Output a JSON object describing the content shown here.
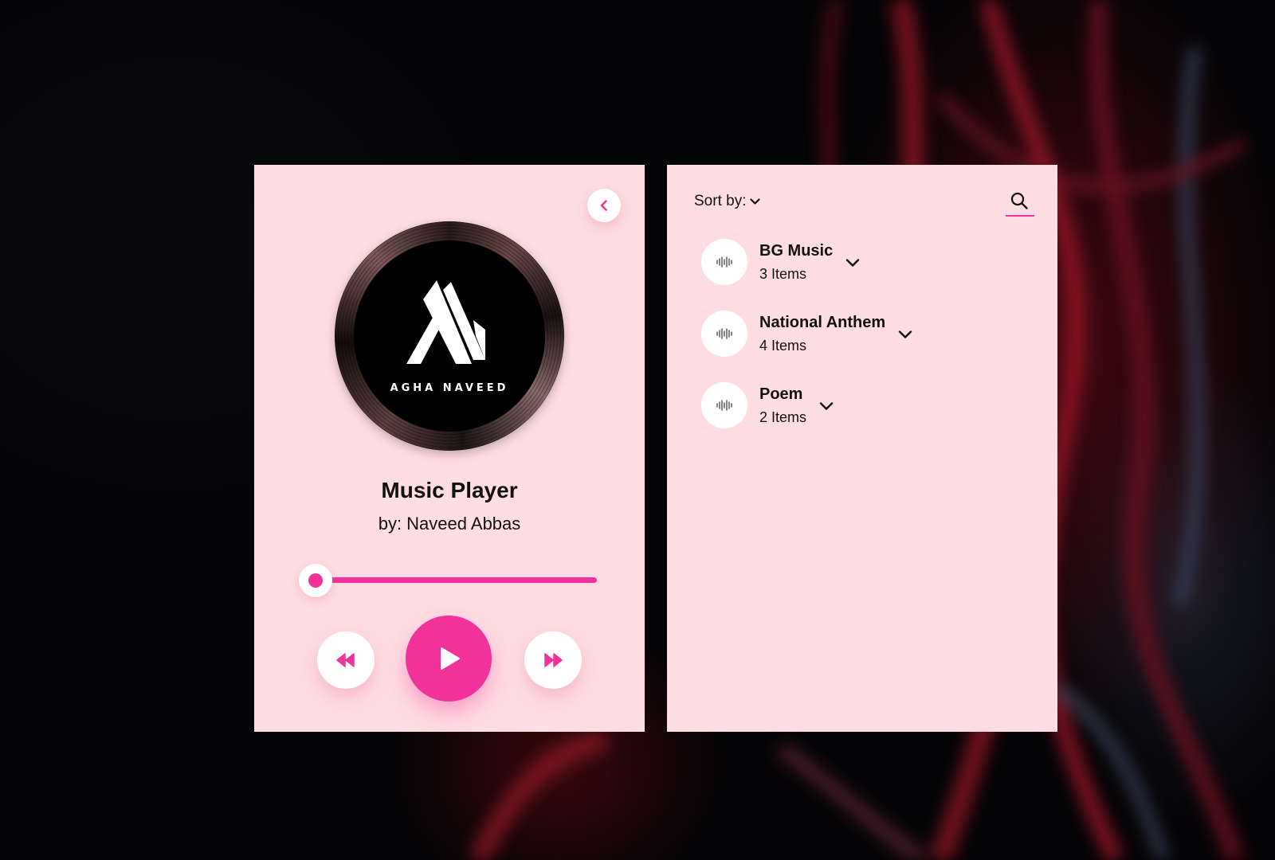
{
  "player": {
    "title": "Music Player",
    "artist": "by: Naveed Abbas",
    "album_art_text": "AGHA NAVEED",
    "progress_fraction": 0.0,
    "accent_color": "#f0329a",
    "card_color": "#ffdde2",
    "icons": {
      "back": "chevron-left-icon",
      "prev": "rewind-icon",
      "play": "play-icon",
      "next": "fast-forward-icon"
    }
  },
  "library": {
    "sort_label": "Sort by:",
    "search_icon": "search-icon",
    "playlists": [
      {
        "name": "BG Music",
        "count": "3 Items"
      },
      {
        "name": "National Anthem",
        "count": "4 Items"
      },
      {
        "name": "Poem",
        "count": "2 Items"
      }
    ]
  }
}
